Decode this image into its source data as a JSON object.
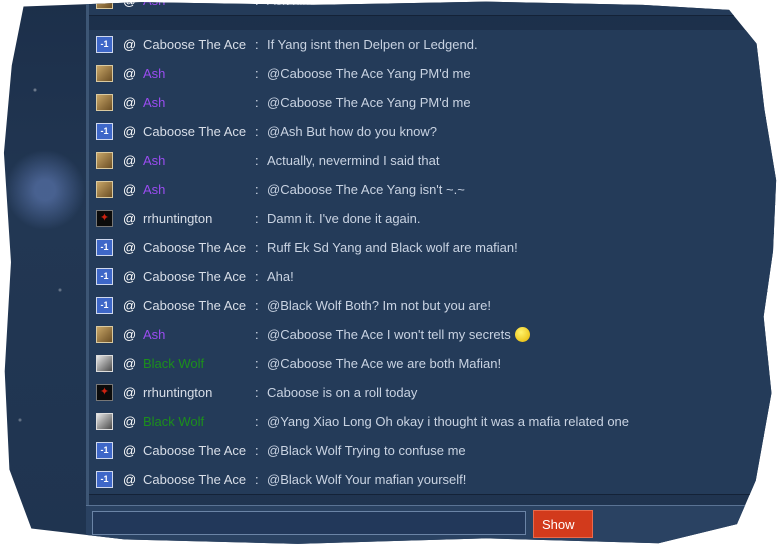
{
  "chat": {
    "messages": [
      {
        "avatar": "ash-avatar",
        "at": "@",
        "name": "Ash",
        "sep": ":",
        "text": "Ask him"
      },
      {
        "avatar": "ace-avatar",
        "at": "@",
        "name": "Caboose The Ace",
        "sep": ":",
        "text": "If Yang isnt then Delpen or Ledgend."
      },
      {
        "avatar": "ash-avatar",
        "at": "@",
        "name": "Ash",
        "sep": ":",
        "text": "@Caboose The Ace Yang PM'd me"
      },
      {
        "avatar": "ash-avatar",
        "at": "@",
        "name": "Ash",
        "sep": ":",
        "text": "@Caboose The Ace Yang PM'd me"
      },
      {
        "avatar": "ace-avatar",
        "at": "@",
        "name": "Caboose The Ace",
        "sep": ":",
        "text": "@Ash But how do you know?"
      },
      {
        "avatar": "ash-avatar",
        "at": "@",
        "name": "Ash",
        "sep": ":",
        "text": "Actually, nevermind I said that"
      },
      {
        "avatar": "ash-avatar",
        "at": "@",
        "name": "Ash",
        "sep": ":",
        "text": "@Caboose The Ace Yang isn't ~.~"
      },
      {
        "avatar": "rrhuntington-avatar",
        "at": "@",
        "name": "rrhuntington",
        "sep": ":",
        "text": "Damn it. I've done it again."
      },
      {
        "avatar": "ace-avatar",
        "at": "@",
        "name": "Caboose The Ace",
        "sep": ":",
        "text": "Ruff Ek Sd Yang and Black wolf are mafian!"
      },
      {
        "avatar": "ace-avatar",
        "at": "@",
        "name": "Caboose The Ace",
        "sep": ":",
        "text": "Aha!"
      },
      {
        "avatar": "ace-avatar",
        "at": "@",
        "name": "Caboose The Ace",
        "sep": ":",
        "text": "@Black Wolf Both? Im not but you are!"
      },
      {
        "avatar": "ash-avatar",
        "at": "@",
        "name": "Ash",
        "sep": ":",
        "text": "@Caboose The Ace I won't tell my secrets"
      },
      {
        "avatar": "black-wolf-avatar",
        "at": "@",
        "name": "Black Wolf",
        "sep": ":",
        "text": "@Caboose The Ace we are both Mafian!"
      },
      {
        "avatar": "rrhuntington-avatar",
        "at": "@",
        "name": "rrhuntington",
        "sep": ":",
        "text": "Caboose is on a roll today"
      },
      {
        "avatar": "black-wolf-avatar",
        "at": "@",
        "name": "Black Wolf",
        "sep": ":",
        "text": "@Yang Xiao Long Oh okay i thought it was a mafia related one"
      },
      {
        "avatar": "ace-avatar",
        "at": "@",
        "name": "Caboose The Ace",
        "sep": ":",
        "text": "@Black Wolf Trying to confuse me"
      },
      {
        "avatar": "ace-avatar",
        "at": "@",
        "name": "Caboose The Ace",
        "sep": ":",
        "text": "@Black Wolf Your mafian yourself!"
      }
    ],
    "input_value": "",
    "show_label": "Show"
  },
  "colors": {
    "ash": "#9a4cf0",
    "black_wolf": "#1c8f1c",
    "default_name": "#d8dee8",
    "message": "#c9d3e2",
    "show_button": "#d23a1c"
  }
}
